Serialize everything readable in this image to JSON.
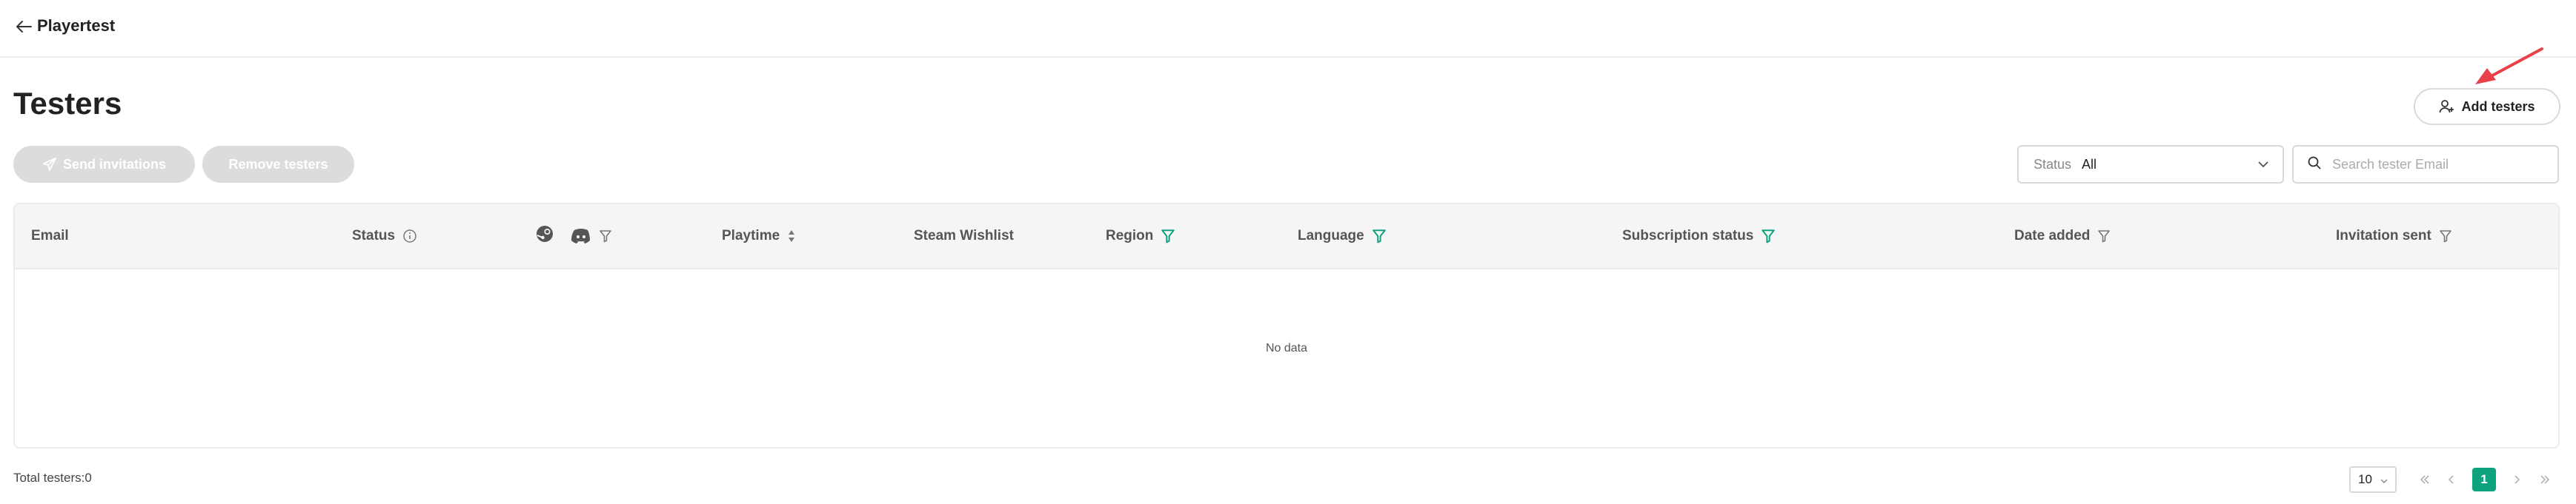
{
  "header": {
    "app_title": "Playertest",
    "back_icon": "arrow-left-icon"
  },
  "page": {
    "title": "Testers"
  },
  "toolbar": {
    "send_invitations_label": "Send invitations",
    "remove_testers_label": "Remove testers",
    "add_testers_label": "Add testers",
    "status_filter": {
      "label": "Status",
      "value": "All"
    },
    "search": {
      "placeholder": "Search tester Email",
      "value": ""
    }
  },
  "table": {
    "columns": [
      {
        "key": "email",
        "label": "Email"
      },
      {
        "key": "status",
        "label": "Status",
        "icon": "info-icon"
      },
      {
        "key": "platforms",
        "label": "",
        "icons": [
          "steam-icon",
          "discord-icon",
          "filter-icon"
        ]
      },
      {
        "key": "playtime",
        "label": "Playtime",
        "icon": "sort-icon"
      },
      {
        "key": "steam_wishlist",
        "label": "Steam Wishlist"
      },
      {
        "key": "region",
        "label": "Region",
        "icon": "filter-icon"
      },
      {
        "key": "language",
        "label": "Language",
        "icon": "filter-icon"
      },
      {
        "key": "subscription_status",
        "label": "Subscription status",
        "icon": "filter-icon"
      },
      {
        "key": "date_added",
        "label": "Date added",
        "icon": "filter-icon"
      },
      {
        "key": "invitation_sent",
        "label": "Invitation sent",
        "icon": "filter-icon"
      }
    ],
    "rows": [],
    "empty_text": "No data"
  },
  "footer": {
    "total_label": "Total testers:0",
    "page_size": "10",
    "current_page": "1"
  },
  "colors": {
    "accent": "#0fa27e",
    "disabled_button": "#dcdcdc",
    "annotation_arrow": "#e8414a"
  }
}
